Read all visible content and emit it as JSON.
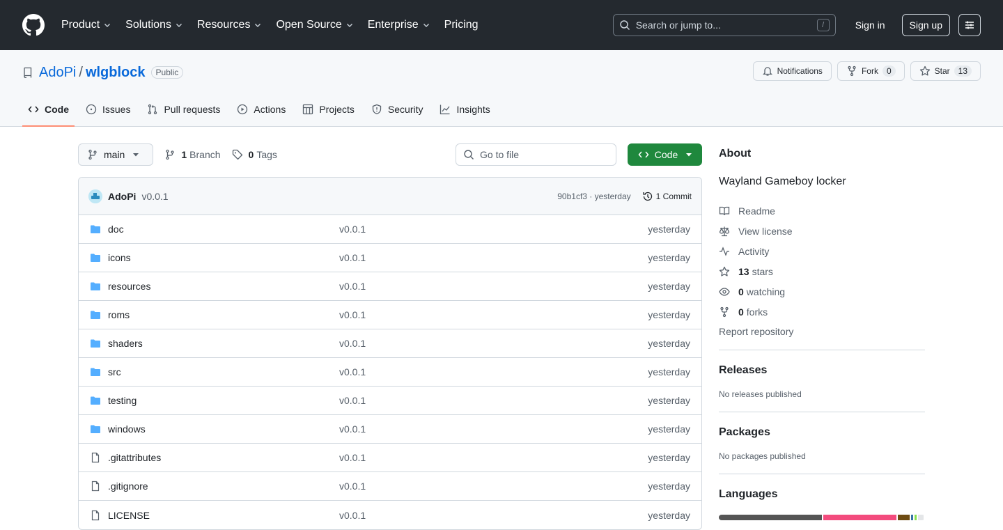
{
  "header": {
    "nav": [
      {
        "label": "Product",
        "dropdown": true
      },
      {
        "label": "Solutions",
        "dropdown": true
      },
      {
        "label": "Resources",
        "dropdown": true
      },
      {
        "label": "Open Source",
        "dropdown": true
      },
      {
        "label": "Enterprise",
        "dropdown": true
      },
      {
        "label": "Pricing",
        "dropdown": false
      }
    ],
    "search_placeholder": "Search or jump to...",
    "search_shortcut": "/",
    "sign_in": "Sign in",
    "sign_up": "Sign up"
  },
  "repo": {
    "owner": "AdoPi",
    "separator": "/",
    "name": "wlgblock",
    "visibility": "Public",
    "notifications_label": "Notifications",
    "fork_label": "Fork",
    "fork_count": "0",
    "star_label": "Star",
    "star_count": "13"
  },
  "tabs": [
    {
      "label": "Code",
      "icon": "code-icon",
      "active": true
    },
    {
      "label": "Issues",
      "icon": "issue-icon",
      "active": false
    },
    {
      "label": "Pull requests",
      "icon": "pull-request-icon",
      "active": false
    },
    {
      "label": "Actions",
      "icon": "play-icon",
      "active": false
    },
    {
      "label": "Projects",
      "icon": "table-icon",
      "active": false
    },
    {
      "label": "Security",
      "icon": "shield-icon",
      "active": false
    },
    {
      "label": "Insights",
      "icon": "graph-icon",
      "active": false
    }
  ],
  "toolbar": {
    "branch": "main",
    "branch_count": "1",
    "branch_label": "Branch",
    "tag_count": "0",
    "tag_label": "Tags",
    "goto_placeholder": "Go to file",
    "code_button": "Code"
  },
  "commit": {
    "author": "AdoPi",
    "message": "v0.0.1",
    "hash_time": "90b1cf3 · yesterday",
    "count_label": "1 Commit"
  },
  "files": [
    {
      "name": "doc",
      "type": "folder",
      "commit": "v0.0.1",
      "date": "yesterday"
    },
    {
      "name": "icons",
      "type": "folder",
      "commit": "v0.0.1",
      "date": "yesterday"
    },
    {
      "name": "resources",
      "type": "folder",
      "commit": "v0.0.1",
      "date": "yesterday"
    },
    {
      "name": "roms",
      "type": "folder",
      "commit": "v0.0.1",
      "date": "yesterday"
    },
    {
      "name": "shaders",
      "type": "folder",
      "commit": "v0.0.1",
      "date": "yesterday"
    },
    {
      "name": "src",
      "type": "folder",
      "commit": "v0.0.1",
      "date": "yesterday"
    },
    {
      "name": "testing",
      "type": "folder",
      "commit": "v0.0.1",
      "date": "yesterday"
    },
    {
      "name": "windows",
      "type": "folder",
      "commit": "v0.0.1",
      "date": "yesterday"
    },
    {
      "name": ".gitattributes",
      "type": "file",
      "commit": "v0.0.1",
      "date": "yesterday"
    },
    {
      "name": ".gitignore",
      "type": "file",
      "commit": "v0.0.1",
      "date": "yesterday"
    },
    {
      "name": "LICENSE",
      "type": "file",
      "commit": "v0.0.1",
      "date": "yesterday"
    }
  ],
  "about": {
    "heading": "About",
    "description": "Wayland Gameboy locker",
    "readme": "Readme",
    "license": "View license",
    "activity": "Activity",
    "stars_count": "13",
    "stars_label": "stars",
    "watching_count": "0",
    "watching_label": "watching",
    "forks_count": "0",
    "forks_label": "forks",
    "report": "Report repository"
  },
  "releases": {
    "heading": "Releases",
    "text": "No releases published"
  },
  "packages": {
    "heading": "Packages",
    "text": "No packages published"
  },
  "languages": {
    "heading": "Languages",
    "bar": [
      {
        "color": "#555555",
        "percent": 52
      },
      {
        "color": "#f34b7d",
        "percent": 37
      },
      {
        "color": "#6e4c13",
        "percent": 6
      },
      {
        "color": "#3572a5",
        "percent": 1
      },
      {
        "color": "#89e051",
        "percent": 1
      },
      {
        "color": "#e4e6e8",
        "percent": 3
      }
    ]
  },
  "colors": {
    "header_bg": "#24292f",
    "link": "#0969da",
    "primary_button": "#1f883d",
    "active_tab_underline": "#fd8c73",
    "folder": "#54aeff"
  }
}
